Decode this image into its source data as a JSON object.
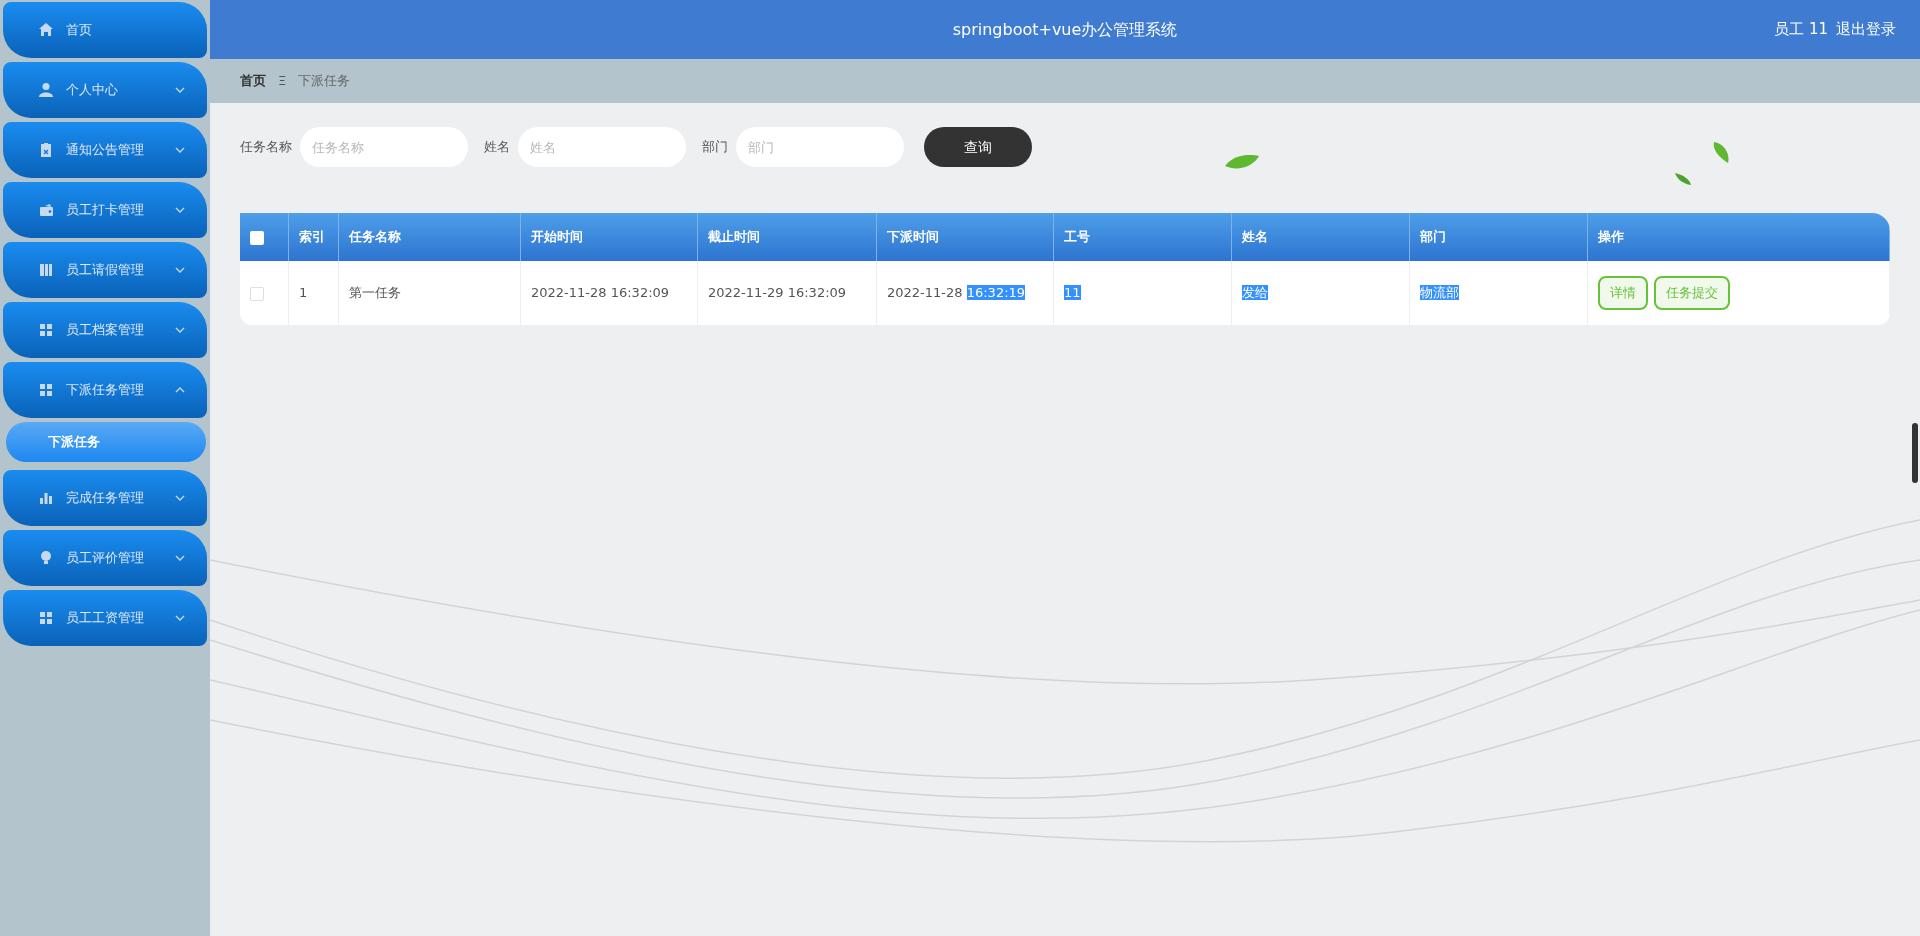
{
  "sidebar": {
    "items": [
      {
        "label": "首页",
        "kind": "link"
      },
      {
        "label": "个人中心",
        "kind": "group",
        "expanded": false
      },
      {
        "label": "通知公告管理",
        "kind": "group",
        "expanded": false
      },
      {
        "label": "员工打卡管理",
        "kind": "group",
        "expanded": false
      },
      {
        "label": "员工请假管理",
        "kind": "group",
        "expanded": false
      },
      {
        "label": "员工档案管理",
        "kind": "group",
        "expanded": false
      },
      {
        "label": "下派任务管理",
        "kind": "group",
        "expanded": true,
        "children": [
          {
            "label": "下派任务",
            "selected": true
          }
        ]
      },
      {
        "label": "完成任务管理",
        "kind": "group",
        "expanded": false
      },
      {
        "label": "员工评价管理",
        "kind": "group",
        "expanded": false
      },
      {
        "label": "员工工资管理",
        "kind": "group",
        "expanded": false
      }
    ]
  },
  "header": {
    "title": "springboot+vue办公管理系统",
    "user": "员工 11",
    "logout": "退出登录"
  },
  "breadcrumb": {
    "items": [
      "首页",
      "下派任务"
    ],
    "separator": "Ξ"
  },
  "search": {
    "fields": [
      {
        "label": "任务名称",
        "placeholder": "任务名称"
      },
      {
        "label": "姓名",
        "placeholder": "姓名"
      },
      {
        "label": "部门",
        "placeholder": "部门"
      }
    ],
    "button": "查询"
  },
  "table": {
    "select_all_checked": false,
    "columns": [
      "索引",
      "任务名称",
      "开始时间",
      "截止时间",
      "下派时间",
      "工号",
      "姓名",
      "部门",
      "操作"
    ],
    "rows": [
      {
        "checked": false,
        "cells": [
          [
            {
              "text": "1",
              "highlighted": false
            }
          ],
          [
            {
              "text": "第一任务",
              "highlighted": false
            }
          ],
          [
            {
              "text": "2022-11-28 16:32:09",
              "highlighted": false
            }
          ],
          [
            {
              "text": "2022-11-29 16:32:09",
              "highlighted": false
            }
          ],
          [
            {
              "text": "2022-11-28 ",
              "highlighted": false
            },
            {
              "text": "16:32:19",
              "highlighted": true
            }
          ],
          [
            {
              "text": "11",
              "highlighted": true
            }
          ],
          [
            {
              "text": "发给",
              "highlighted": true
            }
          ],
          [
            {
              "text": "物流部",
              "highlighted": true
            }
          ]
        ],
        "actions": [
          "详情",
          "任务提交"
        ]
      }
    ]
  }
}
